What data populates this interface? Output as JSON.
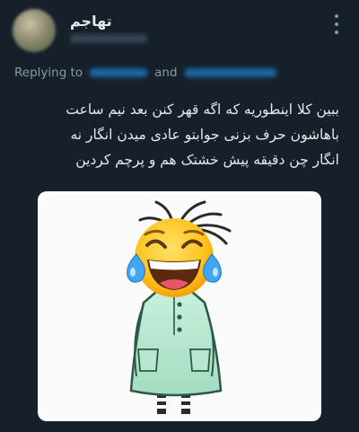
{
  "tweet": {
    "display_name": "تهاجم",
    "replying_prefix": "Replying to",
    "replying_and": "and",
    "text": "ببین کلا اینطوریه که اگه قهر کنن بعد نیم ساعت\nباهاشون حرف بزنی جوابتو عادی میدن انگار نه\nانگار چن دقیقه پیش خشتک هم و پرچم کردین"
  },
  "icons": {
    "more": "more-vertical-icon",
    "media": "laughing-emoji-character-sticker"
  }
}
